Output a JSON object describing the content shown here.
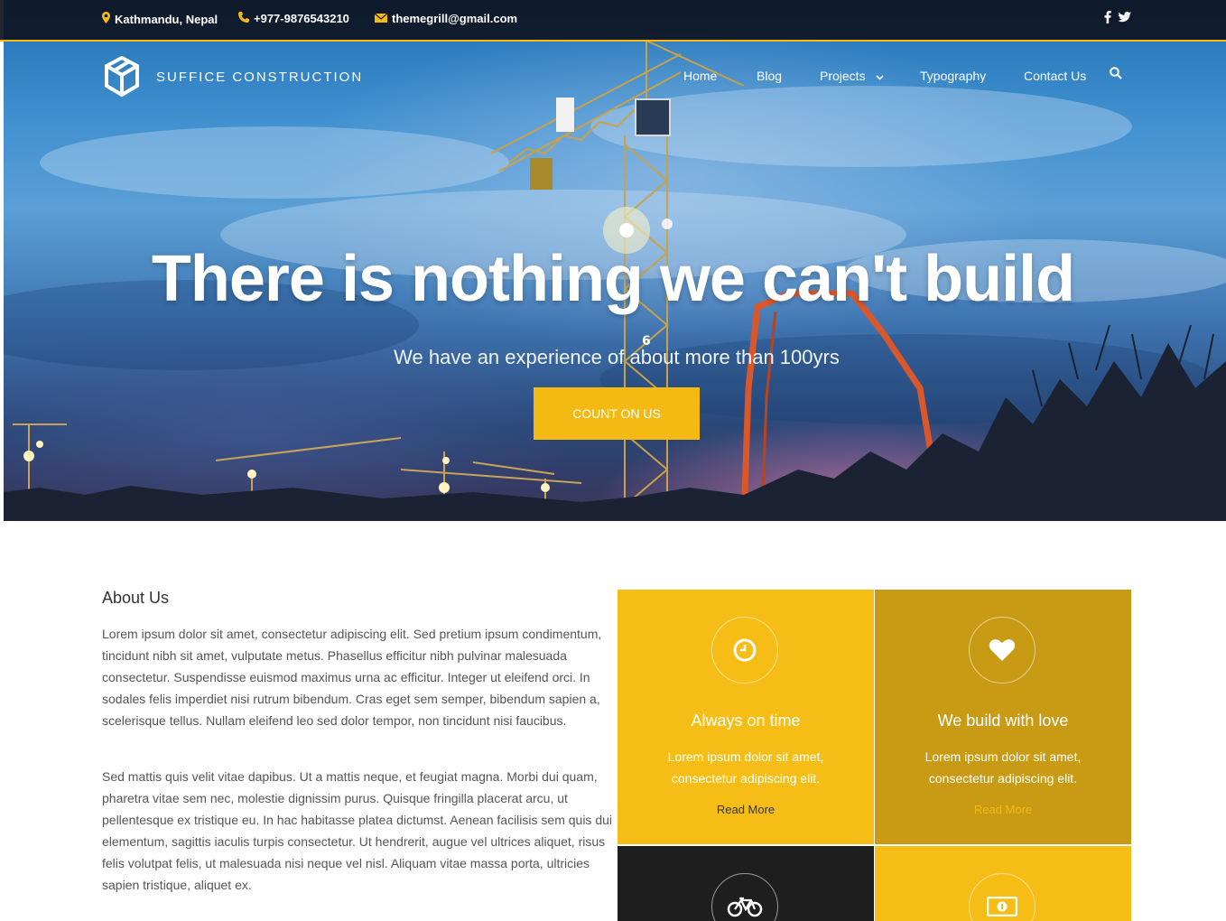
{
  "topbar": {
    "location": "Kathmandu, Nepal",
    "phone": "+977-9876543210",
    "email": "themegrill@gmail.com"
  },
  "brand": {
    "name": "SUFFICE CONSTRUCTION"
  },
  "nav": {
    "items": [
      {
        "label": "Home"
      },
      {
        "label": "Blog"
      },
      {
        "label": "Projects"
      },
      {
        "label": "Typography"
      },
      {
        "label": "Contact Us"
      }
    ]
  },
  "hero": {
    "title": "There is nothing we can't build",
    "subtitle": "We have an experience of about more than 100yrs",
    "cta": "COUNT ON US",
    "crane_number": "6"
  },
  "about": {
    "title": "About Us",
    "paragraphs": [
      "Lorem ipsum dolor sit amet, consectetur adipiscing elit. Sed pretium ipsum condimentum, tincidunt nibh sit amet, vulputate metus. Phasellus efficitur nibh pulvinar malesuada consectetur. Suspendisse euismod maximus urna ac efficitur. Integer ut eleifend orci. In sodales felis imperdiet nisi rutrum bibendum. Cras eget sem semper, bibendum sapien a, scelerisque tellus. Nullam eleifend leo sed dolor tempor, non tincidunt nisi faucibus.",
      "Sed mattis quis velit vitae dapibus. Ut a mattis neque, et feugiat magna. Morbi dui quam, pharetra vitae sem nec, molestie dignissim purus. Quisque fringilla placerat arcu, ut pellentesque ex tristique eu. In hac habitasse platea dictumst. Aenean facilisis sem quis dui elementum, sagittis iaculis turpis consectetur. Ut hendrerit, augue vel ultrices aliquet, risus felis volutpat felis, ut malesuada nisi neque vel nisl. Aliquam vitae massa porta, ultricies sapien tristique, aliquet ex."
    ]
  },
  "features": [
    {
      "icon": "clock-icon",
      "title": "Always on time",
      "desc": "Lorem ipsum dolor sit amet, consectetur adipiscing elit.",
      "link": "Read More",
      "bg": "#f6bd16",
      "link_color": "#333333"
    },
    {
      "icon": "heart-icon",
      "title": "We build with love",
      "desc": "Lorem ipsum dolor sit amet, consectetur adipiscing elit.",
      "link": "Read More",
      "bg": "#c99a14",
      "link_color": "#f5b914"
    },
    {
      "icon": "bicycle-icon",
      "title": "",
      "desc": "",
      "link": "",
      "bg": "#1e1e1e",
      "link_color": "#f5b914"
    },
    {
      "icon": "money-icon",
      "title": "",
      "desc": "",
      "link": "",
      "bg": "#f6bd16",
      "link_color": "#333333"
    }
  ],
  "colors": {
    "accent": "#f5b914",
    "accent_dark": "#c99a14",
    "dark": "#1e1e1e"
  }
}
